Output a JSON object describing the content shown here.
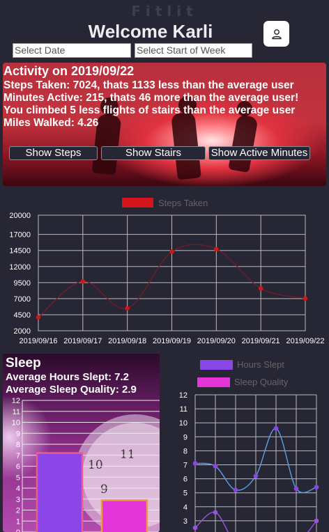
{
  "header": {
    "app_name": "Fitlit",
    "welcome": "Welcome Karli",
    "user_icon": "user-icon"
  },
  "inputs": {
    "date_placeholder": "Select Date",
    "week_placeholder": "Select Start of Week"
  },
  "activity": {
    "title": "Activity on 2019/09/22",
    "steps_line": "Steps Taken: 7024, thats 1133 less than the average user",
    "minutes_line": "Minutes Active: 215, thats 46 more than the average user!",
    "stairs_line": "You climbed 5 less flights of stairs than the average user",
    "miles_line": "Miles Walked: 4.26",
    "buttons": [
      "Show Steps",
      "Show Stairs",
      "Show Active Minutes"
    ]
  },
  "colors": {
    "background": "#262634",
    "steps_series": "#d4151c",
    "steps_line": "#7a1a25",
    "hours_bar": "#8b46e8",
    "quality_bar": "#e335d8",
    "hours_line": "#5aa2e6",
    "quality_line": "#9a55e0"
  },
  "chart_data": [
    {
      "type": "line",
      "series": [
        {
          "name": "Steps Taken",
          "values": [
            4100,
            9700,
            5500,
            14300,
            14700,
            8600,
            7024
          ]
        }
      ],
      "categories": [
        "2019/09/16",
        "2019/09/17",
        "2019/09/18",
        "2019/09/19",
        "2019/09/20",
        "2019/09/21",
        "2019/09/22"
      ],
      "yticks": [
        2000,
        4500,
        7000,
        9500,
        12000,
        14500,
        17000,
        20000
      ],
      "ylim": [
        2000,
        20000
      ],
      "grid": true,
      "legend": "top-center"
    },
    {
      "type": "bar",
      "title": "Sleep",
      "subtitles": [
        "Average Hours Slept: 7.2",
        "Average Sleep Quality: 2.9"
      ],
      "categories": [
        "Average Hours Slept",
        "Average Sleep Quality"
      ],
      "values": [
        7.2,
        2.9
      ],
      "yticks": [
        0,
        1,
        2,
        3,
        4,
        5,
        6,
        7,
        8,
        9,
        10,
        11,
        12
      ],
      "ylim": [
        0,
        12
      ],
      "grid": true
    },
    {
      "type": "line",
      "series": [
        {
          "name": "Hours Slept",
          "values": [
            7.1,
            6.9,
            5.2,
            6.2,
            9.6,
            5.3,
            5.4
          ]
        },
        {
          "name": "Sleep Quality",
          "values": [
            2.5,
            3.6,
            1.4,
            1.5,
            1.2,
            1.3,
            3.0
          ]
        }
      ],
      "yticks": [
        3,
        4,
        5,
        6,
        7,
        8,
        9,
        10,
        11,
        12
      ],
      "ylim": [
        2,
        12
      ],
      "grid": true,
      "legend": "top-center"
    }
  ]
}
